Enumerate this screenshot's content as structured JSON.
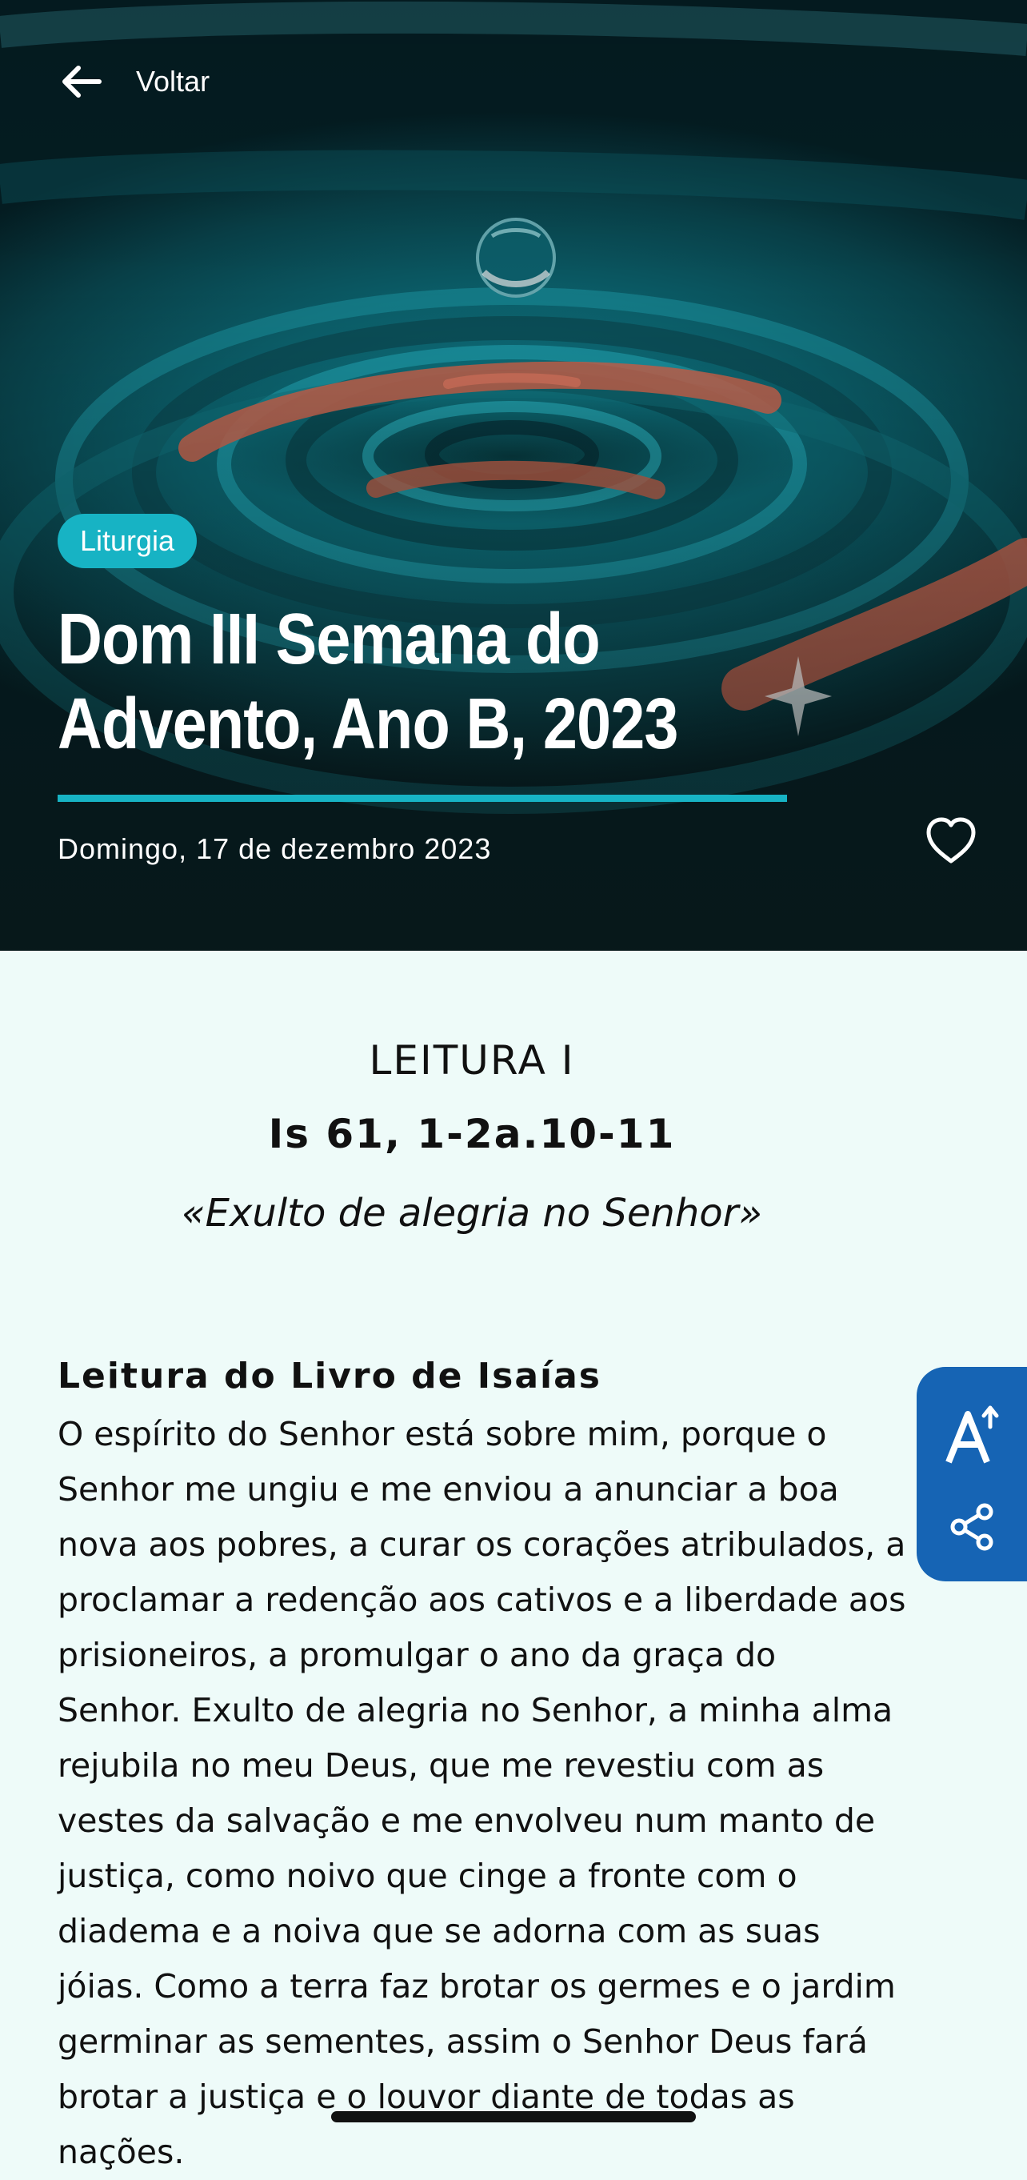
{
  "header": {
    "back_label": "Voltar",
    "category": "Liturgia",
    "title_line1": "Dom III Semana do",
    "title_line2": "Advento, Ano B, 2023",
    "date": "Domingo, 17 de dezembro 2023"
  },
  "reading": {
    "label": "LEITURA I",
    "reference": "Is 61, 1-2a.10-11",
    "quote": "«Exulto de alegria no Senhor»",
    "book": "Leitura do Livro de Isaías",
    "text": "O espírito do Senhor está sobre mim, porque o Senhor me ungiu e me enviou a anunciar a boa nova aos pobres, a curar os corações atribulados, a proclamar a redenção aos cativos e a liberdade aos prisioneiros, a promulgar o ano da graça do Senhor. Exulto de alegria no Senhor, a minha alma rejubila no meu Deus, que me revestiu com as vestes da salvação e me envolveu num manto de justiça, como noivo que cinge a fronte com o diadema e a noiva que se adorna com as suas jóias. Como a terra faz brotar os germes e o jardim germinar as sementes, assim o Senhor Deus fará brotar a justiça e o louvor diante de todas as nações."
  },
  "icons": {
    "back": "arrow-left-icon",
    "favorite": "heart-outline-icon",
    "text_size": "text-size-increase-icon",
    "share": "share-icon"
  },
  "colors": {
    "accent": "#17B3C4",
    "fab": "#1664B4",
    "page_background": "#EEFBF9",
    "text": "#111111"
  }
}
